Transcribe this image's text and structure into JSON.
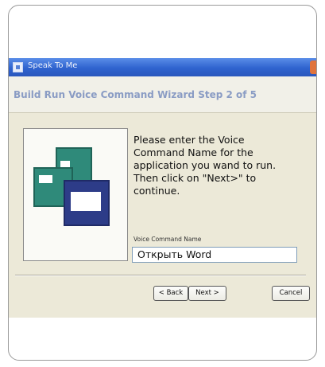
{
  "window": {
    "title": "Speak To Me"
  },
  "wizard": {
    "header_title": "Build Run Voice Command Wizard Step 2 of 5",
    "instruction_lines": [
      "Please enter the Voice",
      "Command Name for the",
      "application you wand to run.",
      "Then click on \"Next>\" to",
      "continue."
    ],
    "field_label": "Voice Command Name",
    "field_value": "Открыть Word"
  },
  "buttons": {
    "back": "< Back",
    "next": "Next >",
    "cancel": "Cancel"
  },
  "icons": {
    "title_app_icon": "app-icon",
    "window_stack_icon": "application-windows-icon"
  },
  "colors": {
    "titlebar": "#2f63cf",
    "dialog_bg": "#ece9d8",
    "header_title": "#8a9cc4",
    "icon_teal": "#2f8a7a",
    "icon_navy": "#2d3c88"
  }
}
